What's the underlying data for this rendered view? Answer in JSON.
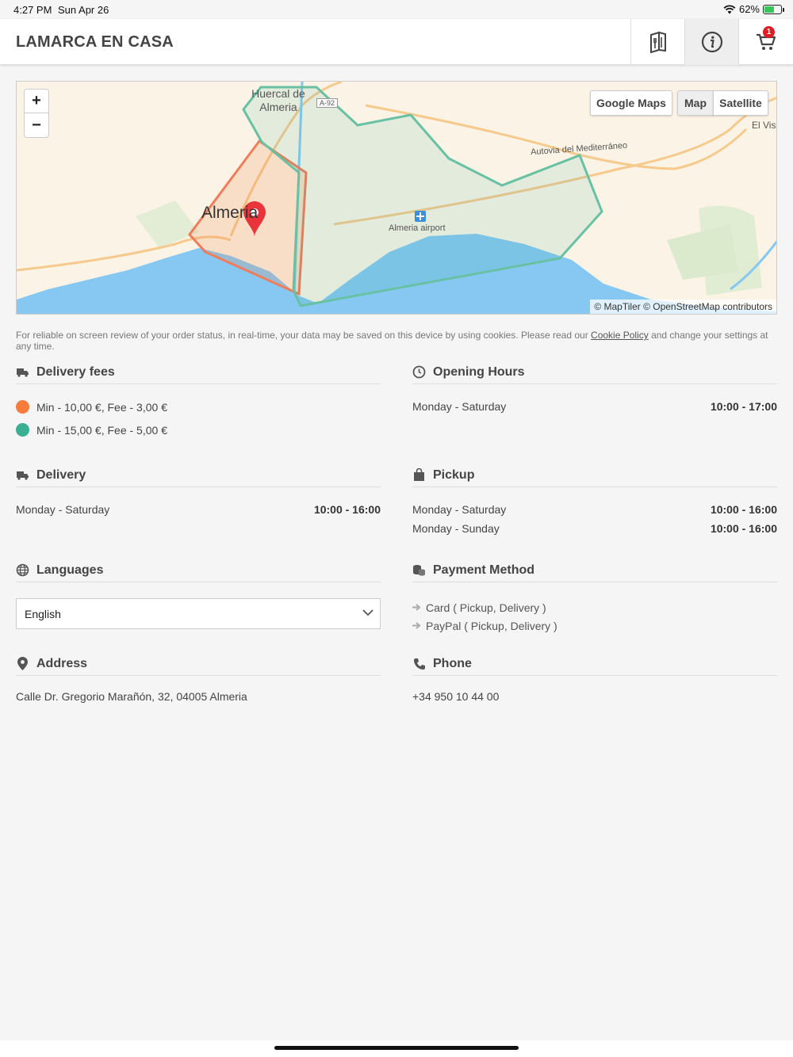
{
  "status_bar": {
    "time": "4:27 PM",
    "date": "Sun Apr 26",
    "battery": "62%"
  },
  "header": {
    "brand": "LAMARCA EN CASA",
    "cart_count": "1"
  },
  "map": {
    "zoom_in": "+",
    "zoom_out": "−",
    "google_maps": "Google Maps",
    "map_type": "Map",
    "satellite": "Satellite",
    "labels": {
      "city": "Almeria",
      "huercal": "Huercal de Almeria",
      "a92": "A-92",
      "el_viso": "El Viso",
      "autovia": "Autovia del Mediterráneo",
      "airport": "Almeria airport"
    },
    "attribution": "© MapTiler © OpenStreetMap contributors"
  },
  "cookie": {
    "text_before": "For reliable on screen review of your order status, in real-time, your data may be saved on this device by using cookies. Please read our ",
    "link": "Cookie Policy",
    "text_after": " and change your settings at any time."
  },
  "delivery_fees": {
    "title": "Delivery fees",
    "items": [
      {
        "label": "Min - 10,00 €, Fee - 3,00 €",
        "color": "#f57c3b"
      },
      {
        "label": "Min - 15,00 €, Fee - 5,00 €",
        "color": "#3aaf93"
      }
    ]
  },
  "opening_hours": {
    "title": "Opening Hours",
    "rows": [
      {
        "days": "Monday - Saturday",
        "hours": "10:00 - 17:00"
      }
    ]
  },
  "delivery": {
    "title": "Delivery",
    "rows": [
      {
        "days": "Monday - Saturday",
        "hours": "10:00 - 16:00"
      }
    ]
  },
  "pickup": {
    "title": "Pickup",
    "rows": [
      {
        "days": "Monday - Saturday",
        "hours": "10:00 - 16:00"
      },
      {
        "days": "Monday - Sunday",
        "hours": "10:00 - 16:00"
      }
    ]
  },
  "languages": {
    "title": "Languages",
    "selected": "English"
  },
  "payment": {
    "title": "Payment Method",
    "items": [
      "Card ( Pickup, Delivery )",
      "PayPal ( Pickup, Delivery )"
    ]
  },
  "address": {
    "title": "Address",
    "value": "Calle Dr. Gregorio Marañón, 32, 04005 Almeria"
  },
  "phone": {
    "title": "Phone",
    "value": "+34 950 10 44 00"
  }
}
